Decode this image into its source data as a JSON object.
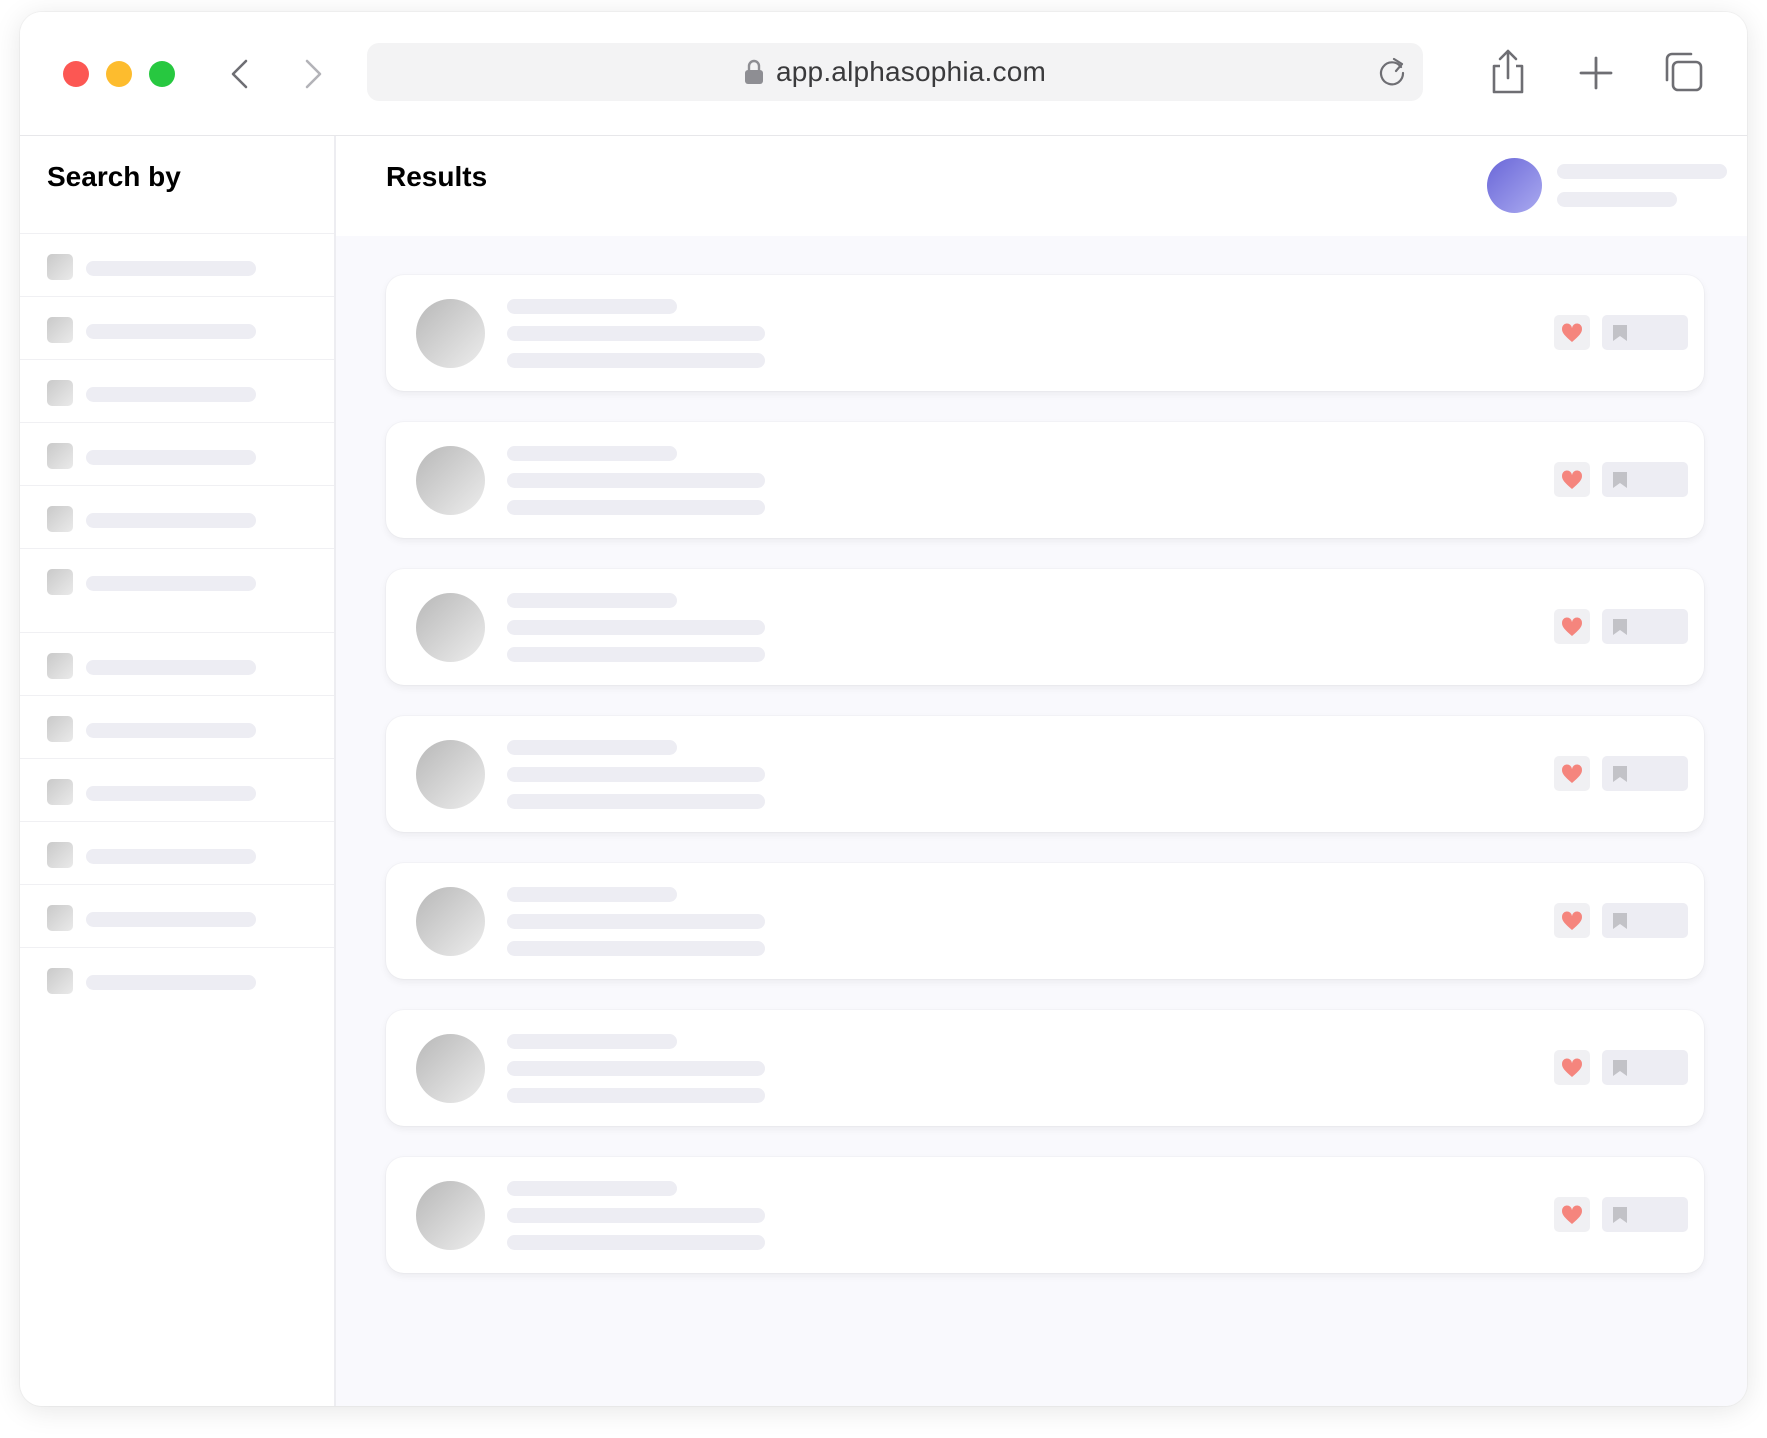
{
  "browser": {
    "url": "app.alphasophia.com",
    "icons": {
      "lock": "lock-icon",
      "back": "chevron-left-icon",
      "forward": "chevron-right-icon",
      "reload": "reload-icon",
      "share": "share-icon",
      "new_tab": "plus-icon",
      "tabs": "tabs-icon"
    },
    "traffic_light_colors": {
      "close": "#fc5753",
      "minimize": "#fdbc2e",
      "zoom": "#27c840"
    }
  },
  "sidebar": {
    "title": "Search by",
    "filter_count": 12
  },
  "main": {
    "title": "Results",
    "result_count": 7,
    "colors": {
      "heart": "#f5857d",
      "avatar_gradient": [
        "#6a67d8",
        "#aaaaf0"
      ]
    }
  }
}
